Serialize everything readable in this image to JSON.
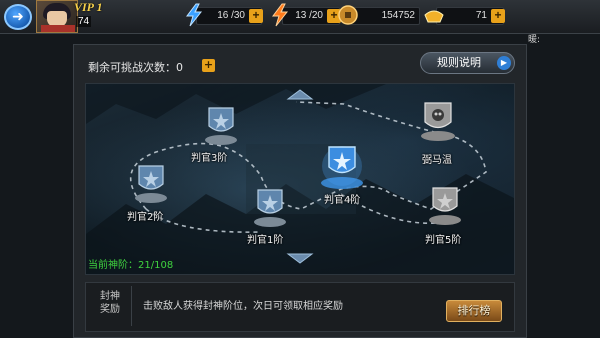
{
  "header": {
    "vip": "VIP 1",
    "level": "74",
    "resources": [
      {
        "icon": "stamina-bolt-icon",
        "value": "16 /30"
      },
      {
        "icon": "energy-bolt-icon",
        "value": "13 /20"
      },
      {
        "icon": "coin-icon",
        "value": "154752"
      },
      {
        "icon": "ingot-icon",
        "value": "71"
      }
    ],
    "sub_text": "暖:"
  },
  "panel": {
    "remaining_label": "剩余可挑战次数：0",
    "rules_button": "规则说明",
    "current_rank": "当前神阶：21/108"
  },
  "map_nodes": [
    {
      "label": "判官3阶",
      "state": "locked"
    },
    {
      "label": "判官2阶",
      "state": "locked"
    },
    {
      "label": "判官1阶",
      "state": "locked"
    },
    {
      "label": "判官4阶",
      "state": "current"
    },
    {
      "label": "弼马温",
      "state": "boss"
    },
    {
      "label": "判官5阶",
      "state": "next"
    }
  ],
  "reward": {
    "title_line1": "封神",
    "title_line2": "奖励",
    "description": "击败敌人获得封神阶位，次日可领取相应奖励",
    "rank_button": "排行榜"
  },
  "colors": {
    "accent_orange": "#e8a11a",
    "rank_green": "#3fd23f",
    "node_blue": "#4aa8ff"
  }
}
